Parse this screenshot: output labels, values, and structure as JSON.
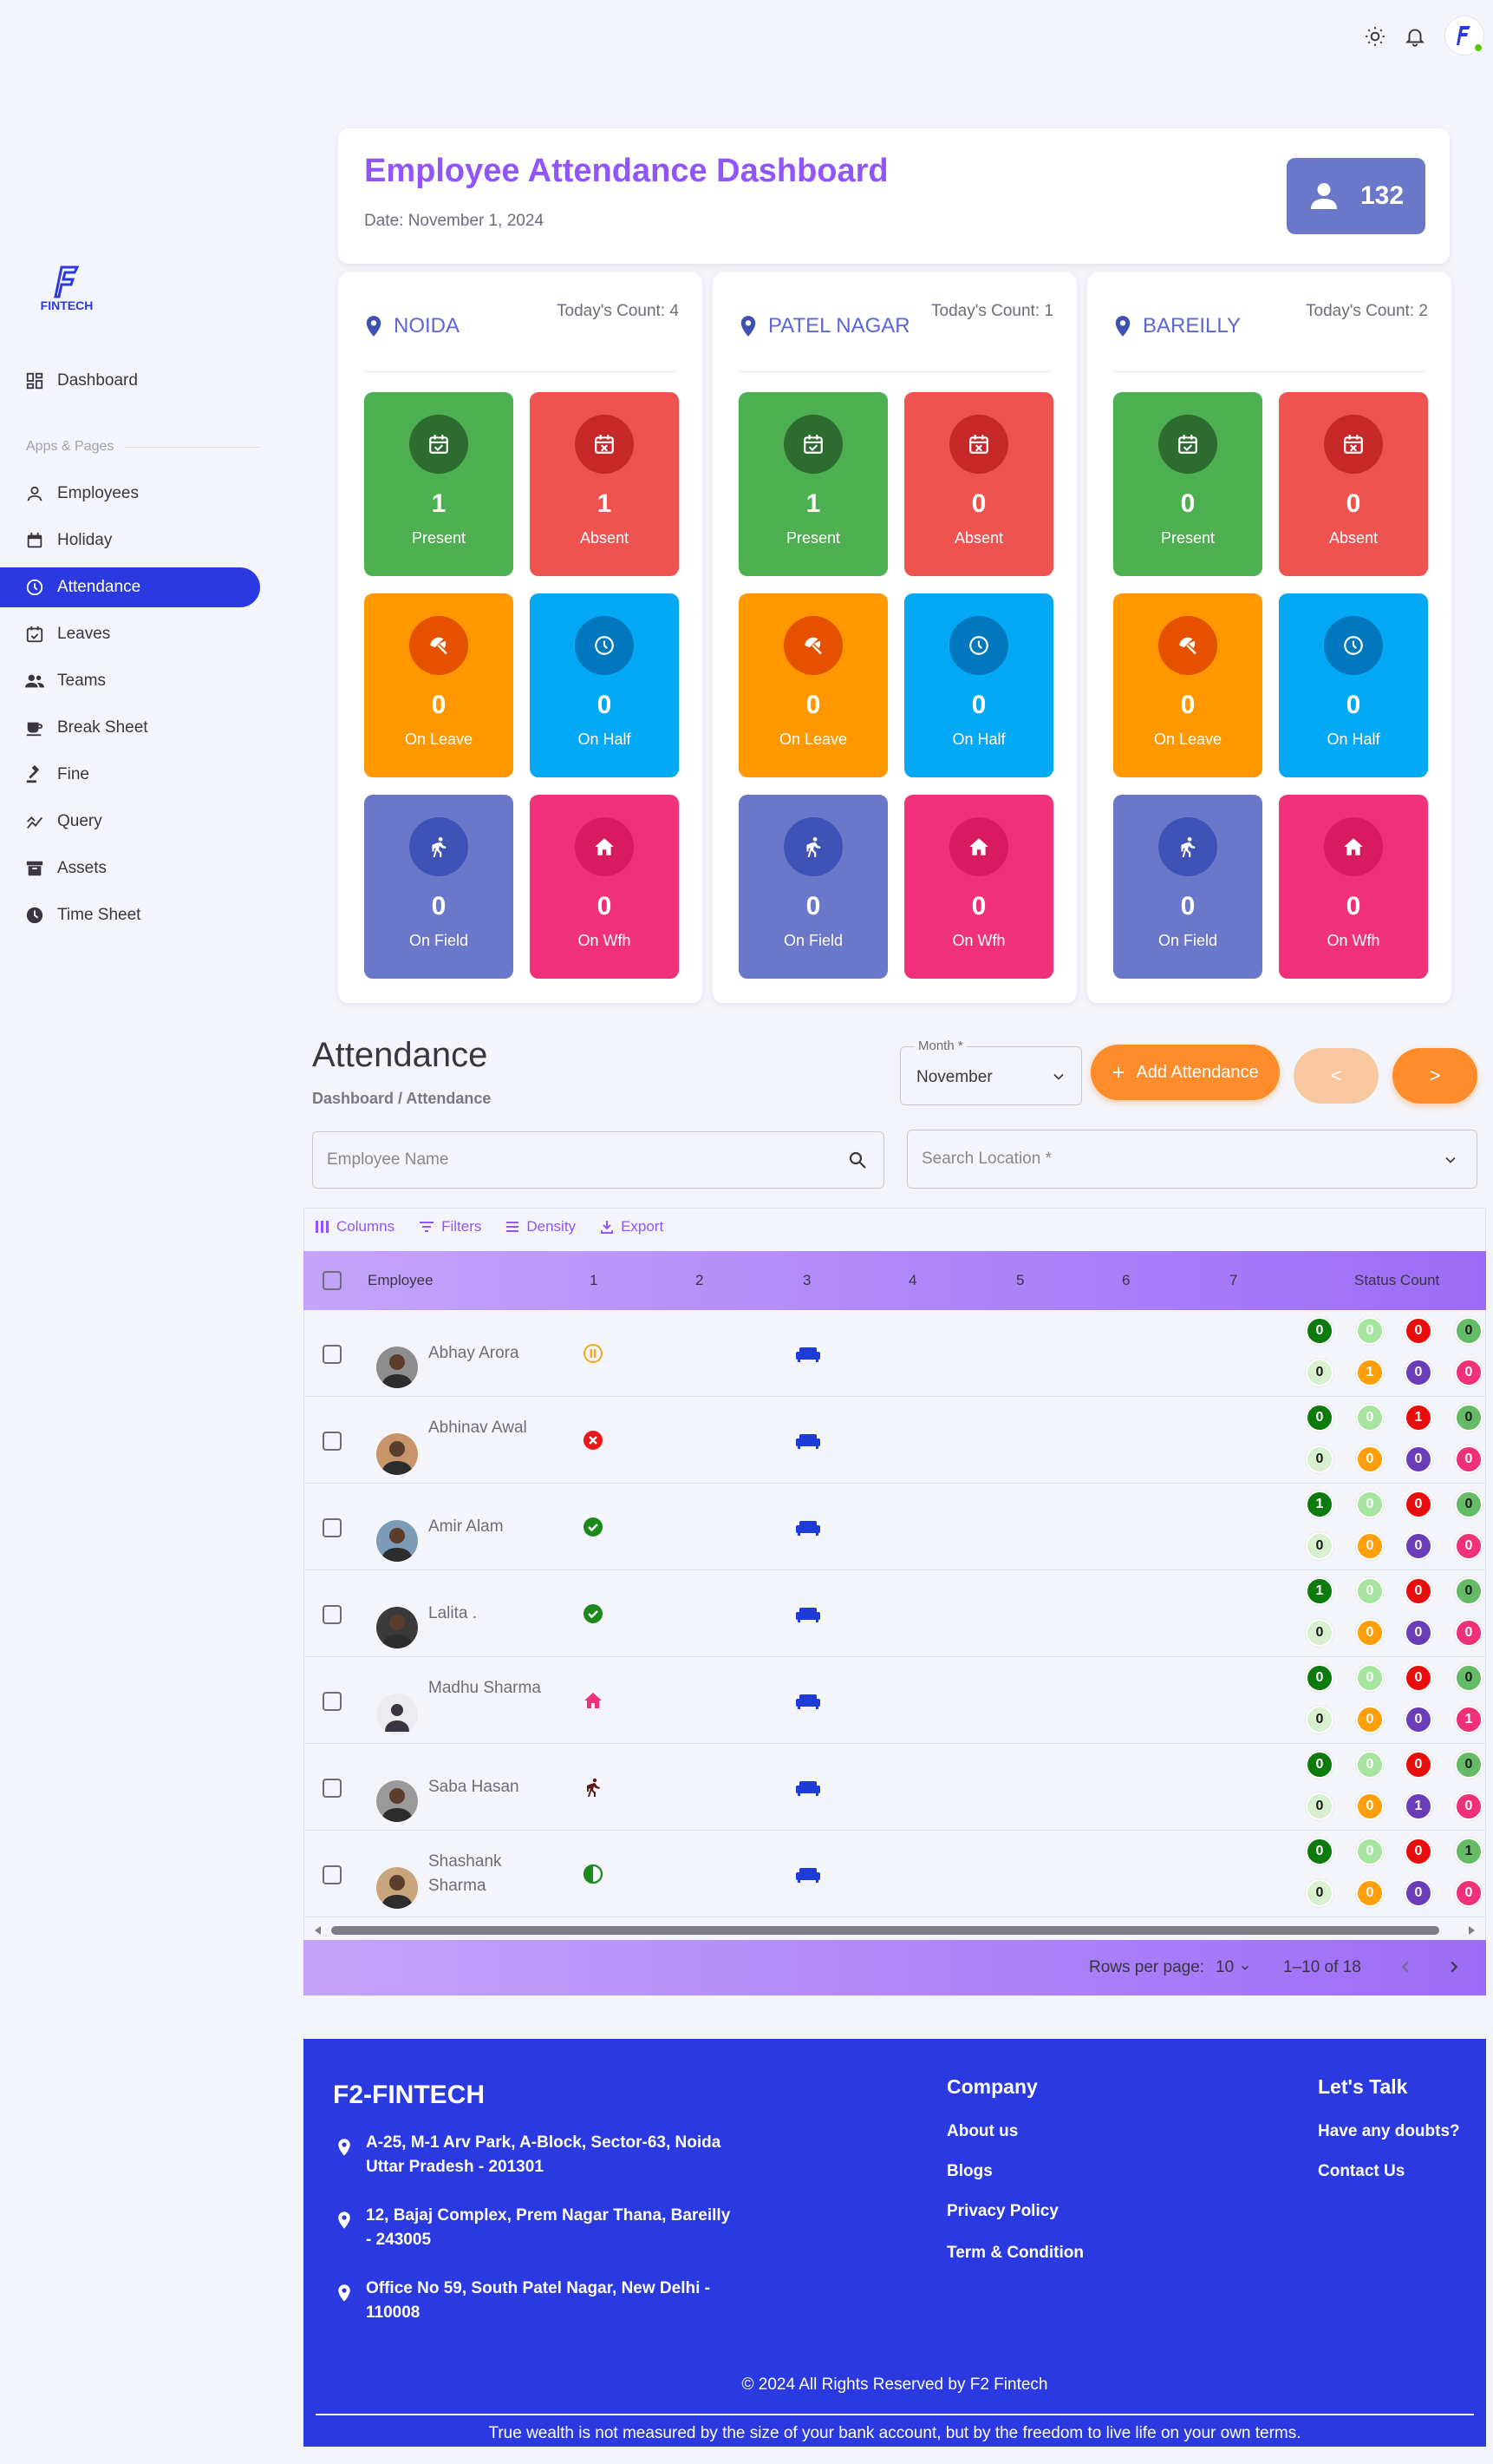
{
  "sidebar": {
    "logo_text": "FINTECH",
    "dashboard": "Dashboard",
    "section_label": "Apps & Pages",
    "items": [
      {
        "label": "Employees",
        "icon": "person-icon"
      },
      {
        "label": "Holiday",
        "icon": "calendar-icon"
      },
      {
        "label": "Attendance",
        "icon": "clock-icon",
        "active": true
      },
      {
        "label": "Leaves",
        "icon": "calendar-check-icon"
      },
      {
        "label": "Teams",
        "icon": "group-icon"
      },
      {
        "label": "Break Sheet",
        "icon": "coffee-icon"
      },
      {
        "label": "Fine",
        "icon": "gavel-icon"
      },
      {
        "label": "Query",
        "icon": "query-chart-icon"
      },
      {
        "label": "Assets",
        "icon": "archive-icon"
      },
      {
        "label": "Time Sheet",
        "icon": "clock-filled-icon"
      }
    ]
  },
  "header": {
    "title": "Employee Attendance Dashboard",
    "date": "Date: November 1, 2024",
    "total_employees": "132"
  },
  "locations": [
    {
      "name": "NOIDA",
      "count_label": "Today's Count: 4",
      "present": "1",
      "absent": "1",
      "on_leave": "0",
      "on_half": "0",
      "on_field": "0",
      "on_wfh": "0"
    },
    {
      "name": "PATEL NAGAR",
      "count_label": "Today's Count: 1",
      "present": "1",
      "absent": "0",
      "on_leave": "0",
      "on_half": "0",
      "on_field": "0",
      "on_wfh": "0"
    },
    {
      "name": "BAREILLY",
      "count_label": "Today's Count: 2",
      "present": "0",
      "absent": "0",
      "on_leave": "0",
      "on_half": "0",
      "on_field": "0",
      "on_wfh": "0"
    }
  ],
  "tile_labels": {
    "present": "Present",
    "absent": "Absent",
    "on_leave": "On Leave",
    "on_half": "On Half",
    "on_field": "On Field",
    "on_wfh": "On Wfh"
  },
  "attendance": {
    "title": "Attendance",
    "breadcrumb": "Dashboard / Attendance",
    "month_label": "Month *",
    "month_value": "November",
    "add_button": "Add Attendance",
    "prev_button": "<",
    "next_button": ">",
    "search_placeholder": "Employee Name",
    "location_placeholder": "Search Location *"
  },
  "grid": {
    "toolbar": [
      "Columns",
      "Filters",
      "Density",
      "Export"
    ],
    "columns": [
      "Employee",
      "1",
      "2",
      "3",
      "4",
      "5",
      "6",
      "7",
      "Status Count"
    ],
    "rows": [
      {
        "name": "Abhay Arora",
        "day1": "half-pause-icon",
        "day3": "sofa-icon",
        "counts": [
          "0",
          "0",
          "0",
          "0",
          "0",
          "1",
          "0",
          "0"
        ]
      },
      {
        "name": "Abhinav Awal",
        "day1": "absent-x-icon",
        "day3": "sofa-icon",
        "counts": [
          "0",
          "0",
          "1",
          "0",
          "0",
          "0",
          "0",
          "0"
        ]
      },
      {
        "name": "Amir Alam",
        "day1": "present-check-icon",
        "day3": "sofa-icon",
        "counts": [
          "1",
          "0",
          "0",
          "0",
          "0",
          "0",
          "0",
          "0"
        ]
      },
      {
        "name": "Lalita .",
        "day1": "present-check-icon",
        "day3": "sofa-icon",
        "counts": [
          "1",
          "0",
          "0",
          "0",
          "0",
          "0",
          "0",
          "0"
        ]
      },
      {
        "name": "Madhu Sharma",
        "day1": "home-icon",
        "day3": "sofa-icon",
        "counts": [
          "0",
          "0",
          "0",
          "0",
          "0",
          "0",
          "0",
          "1"
        ]
      },
      {
        "name": "Saba Hasan",
        "day1": "field-run-icon",
        "day3": "sofa-icon",
        "counts": [
          "0",
          "0",
          "0",
          "0",
          "0",
          "0",
          "1",
          "0"
        ]
      },
      {
        "name": "Shashank Sharma",
        "day1": "half-circle-icon",
        "day3": "sofa-icon",
        "counts": [
          "0",
          "0",
          "0",
          "1",
          "0",
          "0",
          "0",
          "0"
        ]
      }
    ],
    "rows_per_page_label": "Rows per page:",
    "rows_per_page": "10",
    "range": "1–10 of 18"
  },
  "footer": {
    "brand": "F2-FINTECH",
    "addresses": [
      "A-25, M-1 Arv Park, A-Block, Sector-63, Noida Uttar Pradesh - 201301",
      "12, Bajaj Complex, Prem Nagar Thana, Bareilly - 243005",
      "Office No 59, South Patel Nagar, New Delhi - 110008"
    ],
    "company_heading": "Company",
    "company_links": [
      "About us",
      "Blogs",
      "Privacy Policy",
      "Term & Condition"
    ],
    "talk_heading": "Let's Talk",
    "talk_links": [
      "Have any doubts?",
      "Contact Us"
    ],
    "copyright": "© 2024 All Rights Reserved by F2 Fintech",
    "quote": "True wealth is not measured by the size of your bank account, but by the freedom to live life on your own terms."
  },
  "colors": {
    "primary": "#2b3ae0",
    "accent": "#9155fd",
    "orange": "#ff8c2a",
    "present": "#4caf50",
    "absent": "#ef5350",
    "leave": "#ff9800",
    "half": "#03a9f4",
    "field": "#6b77c8",
    "wfh": "#f0317a"
  }
}
